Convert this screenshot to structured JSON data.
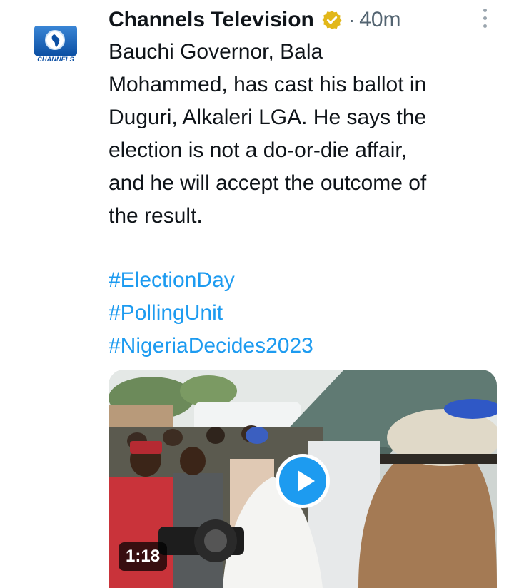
{
  "tweet": {
    "author": "Channels Television",
    "avatar_caption": "CHANNELS",
    "verified_icon": "verified-badge-gold",
    "separator": "·",
    "time": "40m",
    "lines": [
      "Bauchi Governor, Bala",
      "Mohammed, has cast his ballot in",
      "Duguri, Alkaleri LGA. He says the",
      "election is not a do-or-die affair,",
      "and he will accept the outcome of",
      "the result."
    ],
    "hashtags": [
      "#ElectionDay",
      "#PollingUnit",
      "#NigeriaDecides2023"
    ],
    "media": {
      "type": "video",
      "duration": "1:18",
      "play_icon": "play-icon"
    }
  },
  "colors": {
    "link": "#1d9bf0",
    "text": "#0f1419",
    "muted": "#536471",
    "verified": "#e2b719"
  }
}
